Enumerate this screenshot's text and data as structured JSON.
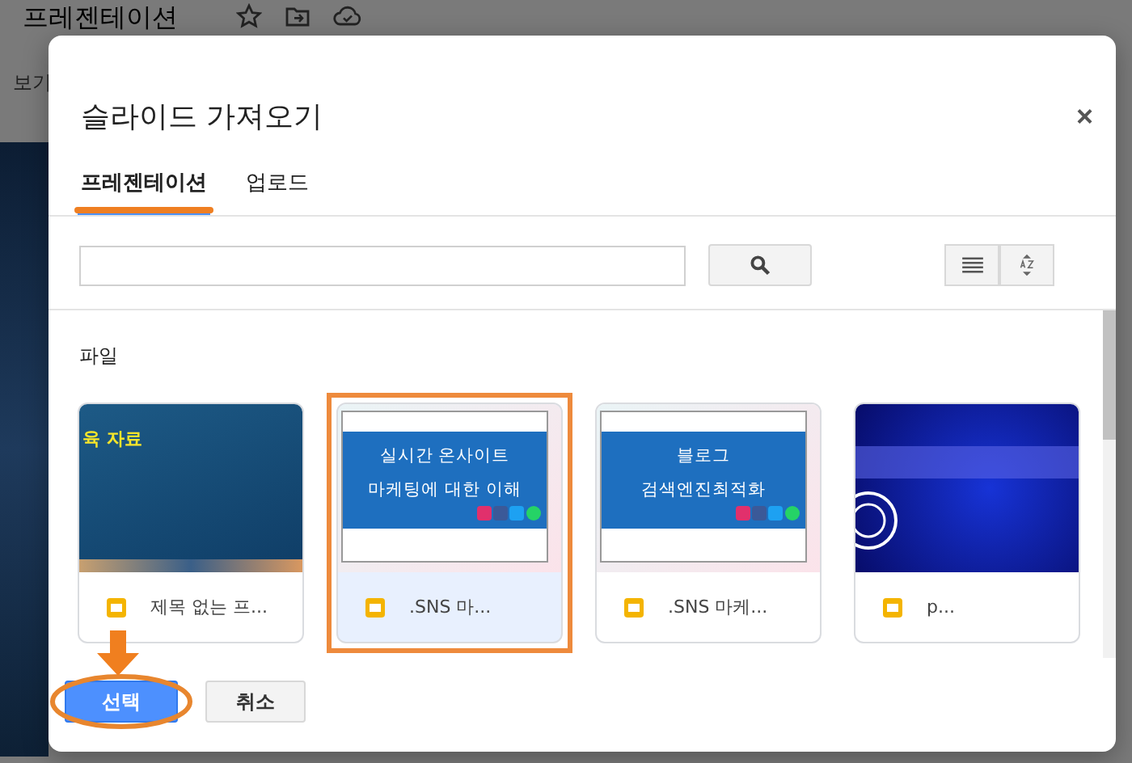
{
  "background": {
    "doc_title": "프레젠테이션",
    "menu_item": "보기"
  },
  "dialog": {
    "title": "슬라이드 가져오기",
    "close": "×",
    "tabs": [
      {
        "label": "프레젠테이션",
        "selected": true,
        "annotated": true
      },
      {
        "label": "업로드",
        "selected": false,
        "annotated": false
      }
    ],
    "section_label": "파일",
    "files": [
      {
        "name": "제목 없는 프...",
        "selected": false,
        "slide": {
          "kind": "dark-title",
          "lines": [
            "육 자료"
          ]
        }
      },
      {
        "name": ".SNS 마...",
        "selected": true,
        "slide": {
          "kind": "banner",
          "lines": [
            "실시간 온사이트",
            "마케팅에 대한 이해"
          ]
        }
      },
      {
        "name": ".SNS 마케...",
        "selected": false,
        "slide": {
          "kind": "banner",
          "lines": [
            "블로그",
            "검색엔진최적화"
          ]
        }
      },
      {
        "name": "p...",
        "selected": false,
        "slide": {
          "kind": "navy"
        }
      }
    ],
    "buttons": [
      {
        "label": "선택",
        "kind": "primary",
        "annotated": true
      },
      {
        "label": "취소",
        "kind": "secondary",
        "annotated": false
      }
    ]
  }
}
